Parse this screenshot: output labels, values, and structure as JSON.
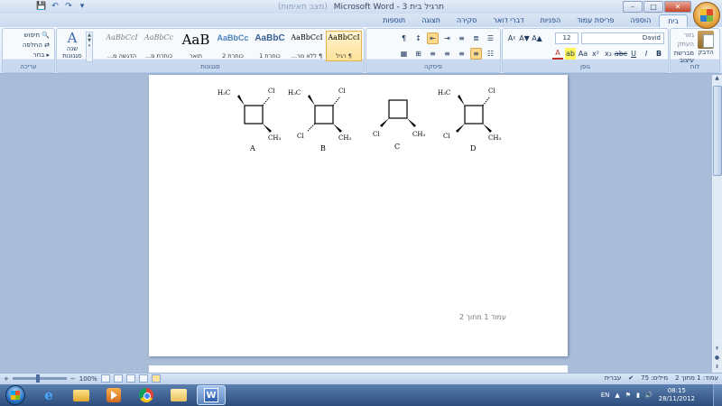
{
  "window": {
    "title": "תרגיל בית 3 - Microsoft Word",
    "title_extra": "(מצב תאימות)",
    "controls": {
      "minimize": "–",
      "maximize": "□",
      "close": "✕"
    }
  },
  "qat": {
    "save_icon": "💾",
    "undo_icon": "↶",
    "redo_icon": "↷",
    "customize_icon": "▾"
  },
  "tabs": [
    "בית",
    "הוספה",
    "פריסת עמוד",
    "הפניות",
    "דברי דואר",
    "סקירה",
    "תצוגה",
    "תוספות"
  ],
  "ribbon": {
    "clipboard": {
      "label": "לוח",
      "paste": "הדבק",
      "cut": "גזור",
      "copy": "העתק",
      "format_painter": "מברשת עיצוב"
    },
    "font": {
      "label": "גופן",
      "font_name": "David",
      "font_size": "12",
      "bold": "B",
      "italic": "I",
      "underline": "U",
      "strike": "abc",
      "subscript": "x₂",
      "superscript": "x²",
      "change_case": "Aa",
      "highlight": "ab",
      "font_color": "A",
      "grow": "A▲",
      "shrink": "A▼",
      "clear": "Aᵡ"
    },
    "paragraph": {
      "label": "פיסקה",
      "row1": [
        "¶",
        "↕",
        "⇤",
        "⇥",
        "≡",
        "≣",
        "☰"
      ],
      "row2": [
        "▦",
        "⊞",
        "≡",
        "≡",
        "≡",
        "≡",
        "☷"
      ]
    },
    "styles": {
      "label": "סגנונות",
      "change_styles": "שנה סגנונות",
      "change_icon": "A",
      "items": [
        {
          "sample": "AaBbCcI",
          "name": "¶ רגיל",
          "selected": true,
          "kind": "normal"
        },
        {
          "sample": "AaBbCcI",
          "name": "¶ ללא מר...",
          "selected": false,
          "kind": "normal"
        },
        {
          "sample": "AaBbC",
          "name": "כותרת 1",
          "selected": false,
          "kind": "blue"
        },
        {
          "sample": "AaBbCc",
          "name": "כותרת 2",
          "selected": false,
          "kind": "blue2"
        },
        {
          "sample": "AaB",
          "name": "תואר",
          "selected": false,
          "kind": "big"
        },
        {
          "sample": "AaBbCc",
          "name": "כותרת מ...",
          "selected": false,
          "kind": "grey"
        },
        {
          "sample": "AaBbCcI",
          "name": "הדגשה מ...",
          "selected": false,
          "kind": "grey"
        }
      ]
    },
    "editing": {
      "label": "עריכה",
      "find": "חיפוש",
      "replace": "החלפה",
      "select": "בחר"
    }
  },
  "document": {
    "molecules": [
      {
        "label": "A",
        "tl": "H₃C",
        "tr": "Cl",
        "br": "CH₃",
        "bl": ""
      },
      {
        "label": "B",
        "tl": "H₃C",
        "tr": "Cl",
        "br": "CH₃",
        "bl": "Cl"
      },
      {
        "label": "C",
        "tl": "",
        "tr": "",
        "br": "CH₃",
        "bl": "Cl"
      },
      {
        "label": "D",
        "tl": "H₃C",
        "tr": "Cl",
        "br": "CH₃",
        "bl": "Cl"
      }
    ],
    "footer": "עמוד 1 מתוך 2"
  },
  "statusbar": {
    "page": "עמוד: 1 מתוך 2",
    "words": "מילים: 75",
    "language": "עברית",
    "zoom": "100%",
    "zoom_minus": "−",
    "zoom_plus": "+"
  },
  "taskbar": {
    "lang": "EN",
    "time": "08:15",
    "date": "28/11/2012",
    "tray_icons": [
      "▲",
      "⚑",
      "▮",
      "🔊"
    ]
  }
}
